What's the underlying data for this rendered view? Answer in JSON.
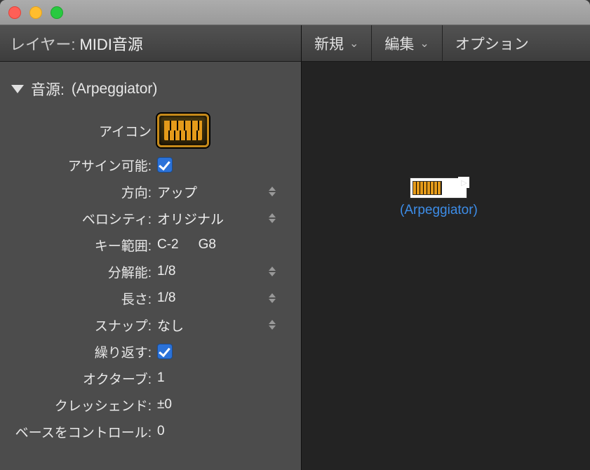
{
  "header": {
    "label": "レイヤー:",
    "value": "MIDI音源"
  },
  "section": {
    "label_prefix": "音源:",
    "name": "(Arpeggiator)"
  },
  "params": {
    "icon_label": "アイコン",
    "assignable": {
      "label": "アサイン可能:",
      "checked": true
    },
    "direction": {
      "label": "方向:",
      "value": "アップ"
    },
    "velocity": {
      "label": "ベロシティ:",
      "value": "オリジナル"
    },
    "key_range": {
      "label": "キー範囲:",
      "low": "C-2",
      "high": "G8"
    },
    "resolution": {
      "label": "分解能:",
      "value": "1/8"
    },
    "length": {
      "label": "長さ:",
      "value": "1/8"
    },
    "snap": {
      "label": "スナップ:",
      "value": "なし"
    },
    "repeat": {
      "label": "繰り返す:",
      "checked": true
    },
    "octave": {
      "label": "オクターブ:",
      "value": "1"
    },
    "crescendo": {
      "label": "クレッシェンド:",
      "value": "±0"
    },
    "base_control": {
      "label": "ベースをコントロール:",
      "value": "0"
    }
  },
  "toolbar": {
    "new_label": "新規",
    "edit_label": "編集",
    "options_label": "オプション"
  },
  "node": {
    "label": "(Arpeggiator)"
  }
}
